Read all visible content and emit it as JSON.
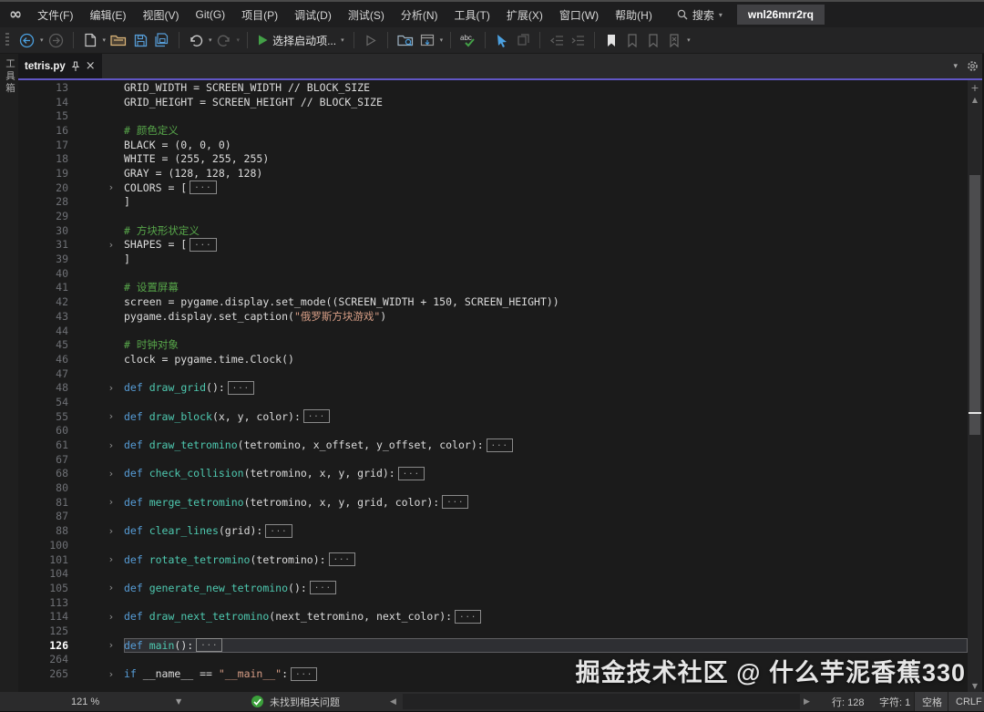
{
  "titlebar": {
    "menus": [
      "文件(F)",
      "编辑(E)",
      "视图(V)",
      "Git(G)",
      "项目(P)",
      "调试(D)",
      "测试(S)",
      "分析(N)",
      "工具(T)",
      "扩展(X)",
      "窗口(W)",
      "帮助(H)"
    ],
    "search_label": "搜索",
    "badge": "wnl26mrr2rq"
  },
  "toolbar": {
    "start_label": "选择启动项..."
  },
  "tab_strip": {
    "toolbox_label": "工具箱",
    "active_tab": "tetris.py"
  },
  "editor": {
    "collapsed_label": "...",
    "lines": [
      {
        "n": 13,
        "t": [
          [
            "GRID_WIDTH = SCREEN_WIDTH // BLOCK_SIZE",
            "p"
          ]
        ]
      },
      {
        "n": 14,
        "t": [
          [
            "GRID_HEIGHT = SCREEN_HEIGHT // BLOCK_SIZE",
            "p"
          ]
        ]
      },
      {
        "n": 15,
        "t": []
      },
      {
        "n": 16,
        "t": [
          [
            "# 颜色定义",
            "c"
          ]
        ]
      },
      {
        "n": 17,
        "t": [
          [
            "BLACK = (0, 0, 0)",
            "p"
          ]
        ]
      },
      {
        "n": 18,
        "t": [
          [
            "WHITE = (255, 255, 255)",
            "p"
          ]
        ]
      },
      {
        "n": 19,
        "t": [
          [
            "GRAY = (128, 128, 128)",
            "p"
          ]
        ]
      },
      {
        "n": 20,
        "f": true,
        "t": [
          [
            "COLORS = [",
            "p"
          ],
          [
            "",
            "b"
          ]
        ]
      },
      {
        "n": 28,
        "t": [
          [
            "]",
            "p"
          ]
        ]
      },
      {
        "n": 29,
        "t": []
      },
      {
        "n": 30,
        "t": [
          [
            "# 方块形状定义",
            "c"
          ]
        ]
      },
      {
        "n": 31,
        "f": true,
        "t": [
          [
            "SHAPES = [",
            "p"
          ],
          [
            "",
            "b"
          ]
        ]
      },
      {
        "n": 39,
        "t": [
          [
            "]",
            "p"
          ]
        ]
      },
      {
        "n": 40,
        "t": []
      },
      {
        "n": 41,
        "t": [
          [
            "# 设置屏幕",
            "c"
          ]
        ]
      },
      {
        "n": 42,
        "t": [
          [
            "screen = pygame.display.set_mode((SCREEN_WIDTH + 150, SCREEN_HEIGHT))",
            "p"
          ]
        ]
      },
      {
        "n": 43,
        "t": [
          [
            "pygame.display.set_caption(",
            "p"
          ],
          [
            "\"俄罗斯方块游戏\"",
            "s"
          ],
          [
            ")",
            "p"
          ]
        ]
      },
      {
        "n": 44,
        "t": []
      },
      {
        "n": 45,
        "t": [
          [
            "# 时钟对象",
            "c"
          ]
        ]
      },
      {
        "n": 46,
        "t": [
          [
            "clock = pygame.time.Clock()",
            "p"
          ]
        ]
      },
      {
        "n": 47,
        "t": []
      },
      {
        "n": 48,
        "f": true,
        "t": [
          [
            "def ",
            "k"
          ],
          [
            "draw_grid",
            "f"
          ],
          [
            "():",
            "p"
          ],
          [
            "",
            "b"
          ]
        ]
      },
      {
        "n": 54,
        "t": []
      },
      {
        "n": 55,
        "f": true,
        "t": [
          [
            "def ",
            "k"
          ],
          [
            "draw_block",
            "f"
          ],
          [
            "(x, y, color):",
            "p"
          ],
          [
            "",
            "b"
          ]
        ]
      },
      {
        "n": 60,
        "t": []
      },
      {
        "n": 61,
        "f": true,
        "t": [
          [
            "def ",
            "k"
          ],
          [
            "draw_tetromino",
            "f"
          ],
          [
            "(tetromino, x_offset, y_offset, color):",
            "p"
          ],
          [
            "",
            "b"
          ]
        ]
      },
      {
        "n": 67,
        "t": []
      },
      {
        "n": 68,
        "f": true,
        "t": [
          [
            "def ",
            "k"
          ],
          [
            "check_collision",
            "f"
          ],
          [
            "(tetromino, x, y, grid):",
            "p"
          ],
          [
            "",
            "b"
          ]
        ]
      },
      {
        "n": 80,
        "t": []
      },
      {
        "n": 81,
        "f": true,
        "t": [
          [
            "def ",
            "k"
          ],
          [
            "merge_tetromino",
            "f"
          ],
          [
            "(tetromino, x, y, grid, color):",
            "p"
          ],
          [
            "",
            "b"
          ]
        ]
      },
      {
        "n": 87,
        "t": []
      },
      {
        "n": 88,
        "f": true,
        "t": [
          [
            "def ",
            "k"
          ],
          [
            "clear_lines",
            "f"
          ],
          [
            "(grid):",
            "p"
          ],
          [
            "",
            "b"
          ]
        ]
      },
      {
        "n": 100,
        "t": []
      },
      {
        "n": 101,
        "f": true,
        "t": [
          [
            "def ",
            "k"
          ],
          [
            "rotate_tetromino",
            "f"
          ],
          [
            "(tetromino):",
            "p"
          ],
          [
            "",
            "b"
          ]
        ]
      },
      {
        "n": 104,
        "t": []
      },
      {
        "n": 105,
        "f": true,
        "t": [
          [
            "def ",
            "k"
          ],
          [
            "generate_new_tetromino",
            "f"
          ],
          [
            "():",
            "p"
          ],
          [
            "",
            "b"
          ]
        ]
      },
      {
        "n": 113,
        "t": []
      },
      {
        "n": 114,
        "f": true,
        "t": [
          [
            "def ",
            "k"
          ],
          [
            "draw_next_tetromino",
            "f"
          ],
          [
            "(next_tetromino, next_color):",
            "p"
          ],
          [
            "",
            "b"
          ]
        ]
      },
      {
        "n": 125,
        "t": []
      },
      {
        "n": 126,
        "f": true,
        "cur": true,
        "t": [
          [
            "def ",
            "k"
          ],
          [
            "main",
            "f"
          ],
          [
            "():",
            "p"
          ],
          [
            "",
            "b"
          ]
        ]
      },
      {
        "n": 264,
        "t": []
      },
      {
        "n": 265,
        "f": true,
        "t": [
          [
            "if ",
            "k"
          ],
          [
            "__name__ == ",
            "p"
          ],
          [
            "\"__main__\"",
            "s"
          ],
          [
            ":",
            "p"
          ],
          [
            "",
            "b"
          ]
        ]
      }
    ]
  },
  "statusbar": {
    "zoom": "121 %",
    "health": "未找到相关问题",
    "line": "行: 128",
    "column": "字符: 1",
    "spaces": "空格",
    "eol": "CRLF"
  },
  "watermark": "掘金技术社区 @ 什么芋泥香蕉330",
  "colors": {
    "accent_purple": "#6156c5",
    "comment_green": "#57a64a",
    "keyword_blue": "#569cd6",
    "function_teal": "#4ec9b0",
    "string_orange": "#d69d85",
    "start_green": "#43a047",
    "health_green": "#3ba03b"
  }
}
